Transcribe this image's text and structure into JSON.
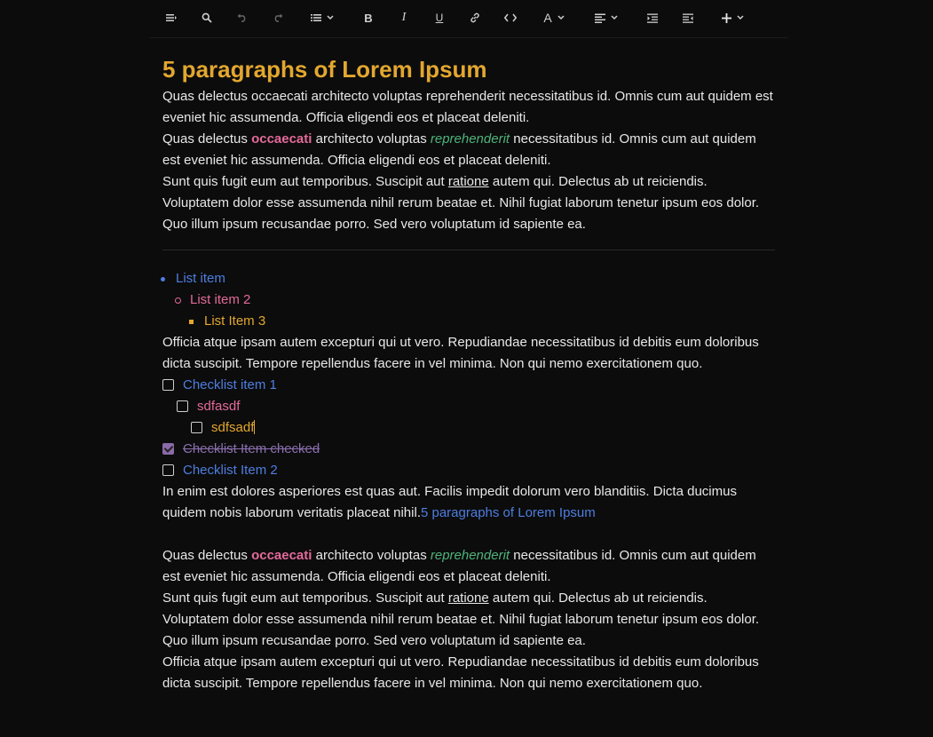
{
  "toolbar": {
    "items": [
      {
        "name": "menu-button",
        "icon": "menu-icon"
      },
      {
        "name": "search-button",
        "icon": "search-icon"
      },
      {
        "name": "undo-button",
        "icon": "undo-icon"
      },
      {
        "name": "redo-button",
        "icon": "redo-icon"
      },
      {
        "name": "list-button",
        "icon": "list-icon"
      },
      {
        "name": "bold-button",
        "icon": "bold-icon",
        "label": "B"
      },
      {
        "name": "italic-button",
        "icon": "italic-icon",
        "label": "I"
      },
      {
        "name": "underline-button",
        "icon": "underline-icon",
        "label": "U"
      },
      {
        "name": "link-button",
        "icon": "link-icon"
      },
      {
        "name": "code-button",
        "icon": "code-icon"
      },
      {
        "name": "font-color-button",
        "icon": "font-color-icon",
        "label": "A"
      },
      {
        "name": "align-button",
        "icon": "align-left-icon"
      },
      {
        "name": "indent-button",
        "icon": "indent-icon"
      },
      {
        "name": "outdent-button",
        "icon": "outdent-icon"
      },
      {
        "name": "insert-button",
        "icon": "plus-icon"
      }
    ]
  },
  "doc": {
    "title": "5 paragraphs of Lorem Ipsum",
    "p1": "Quas delectus occaecati architecto voluptas reprehenderit necessitatibus id. Omnis cum aut quidem est eveniet hic assumenda. Officia eligendi eos et placeat deleniti.",
    "p2": {
      "a": "Quas delectus ",
      "b": "occaecati",
      "c": " architecto voluptas ",
      "d": "reprehenderit",
      "e": " necessitatibus id. Omnis cum aut quidem est eveniet hic assumenda. Officia eligendi eos et placeat deleniti."
    },
    "p3": {
      "a": "Sunt quis fugit eum aut temporibus. Suscipit aut ",
      "b": "ratione",
      "c": " autem qui. Delectus ab ut reiciendis. Voluptatem dolor esse assumenda nihil rerum beatae et. Nihil fugiat laborum tenetur ipsum eos dolor. Quo illum ipsum recusandae porro. Sed vero voluptatum id sapiente ea."
    },
    "list": [
      "List item",
      "List item 2",
      "List Item 3"
    ],
    "p4": "Officia atque ipsam autem excepturi qui ut vero. Repudiandae necessitatibus id debitis eum doloribus dicta suscipit. Tempore repellendus facere in vel minima. Non qui nemo exercitationem quo.",
    "checklist": [
      {
        "label": "Checklist item 1",
        "checked": false
      },
      {
        "label": "sdfasdf",
        "checked": false
      },
      {
        "label": "sdfsadf",
        "checked": false
      },
      {
        "label": "Checklist Item checked",
        "checked": true
      },
      {
        "label": "Checklist Item 2",
        "checked": false
      }
    ],
    "p5": {
      "a": "In enim est dolores asperiores est quas aut. Facilis impedit dolorum vero blanditiis. Dicta ducimus quidem nobis laborum veritatis placeat nihil.",
      "link": "5 paragraphs of Lorem Ipsum"
    },
    "p6": {
      "a": "Quas delectus ",
      "b": "occaecati",
      "c": " architecto voluptas ",
      "d": "reprehenderit",
      "e": " necessitatibus id. Omnis cum aut quidem est eveniet hic assumenda. Officia eligendi eos et placeat deleniti."
    },
    "p7": {
      "a": "Sunt quis fugit eum aut temporibus. Suscipit aut ",
      "b": "ratione",
      "c": " autem qui. Delectus ab ut reiciendis. Voluptatem dolor esse assumenda nihil rerum beatae et. Nihil fugiat laborum tenetur ipsum eos dolor. Quo illum ipsum recusandae porro. Sed vero voluptatum id sapiente ea."
    },
    "p8": "Officia atque ipsam autem excepturi qui ut vero. Repudiandae necessitatibus id debitis eum doloribus dicta suscipit. Tempore repellendus facere in vel minima. Non qui nemo exercitationem quo."
  },
  "colors": {
    "title": "#e3a72f",
    "bold_pink": "#e36a9a",
    "italic_green": "#4fb27a",
    "link_blue": "#4e7ee0",
    "checked_purple": "#8b6fb0"
  }
}
